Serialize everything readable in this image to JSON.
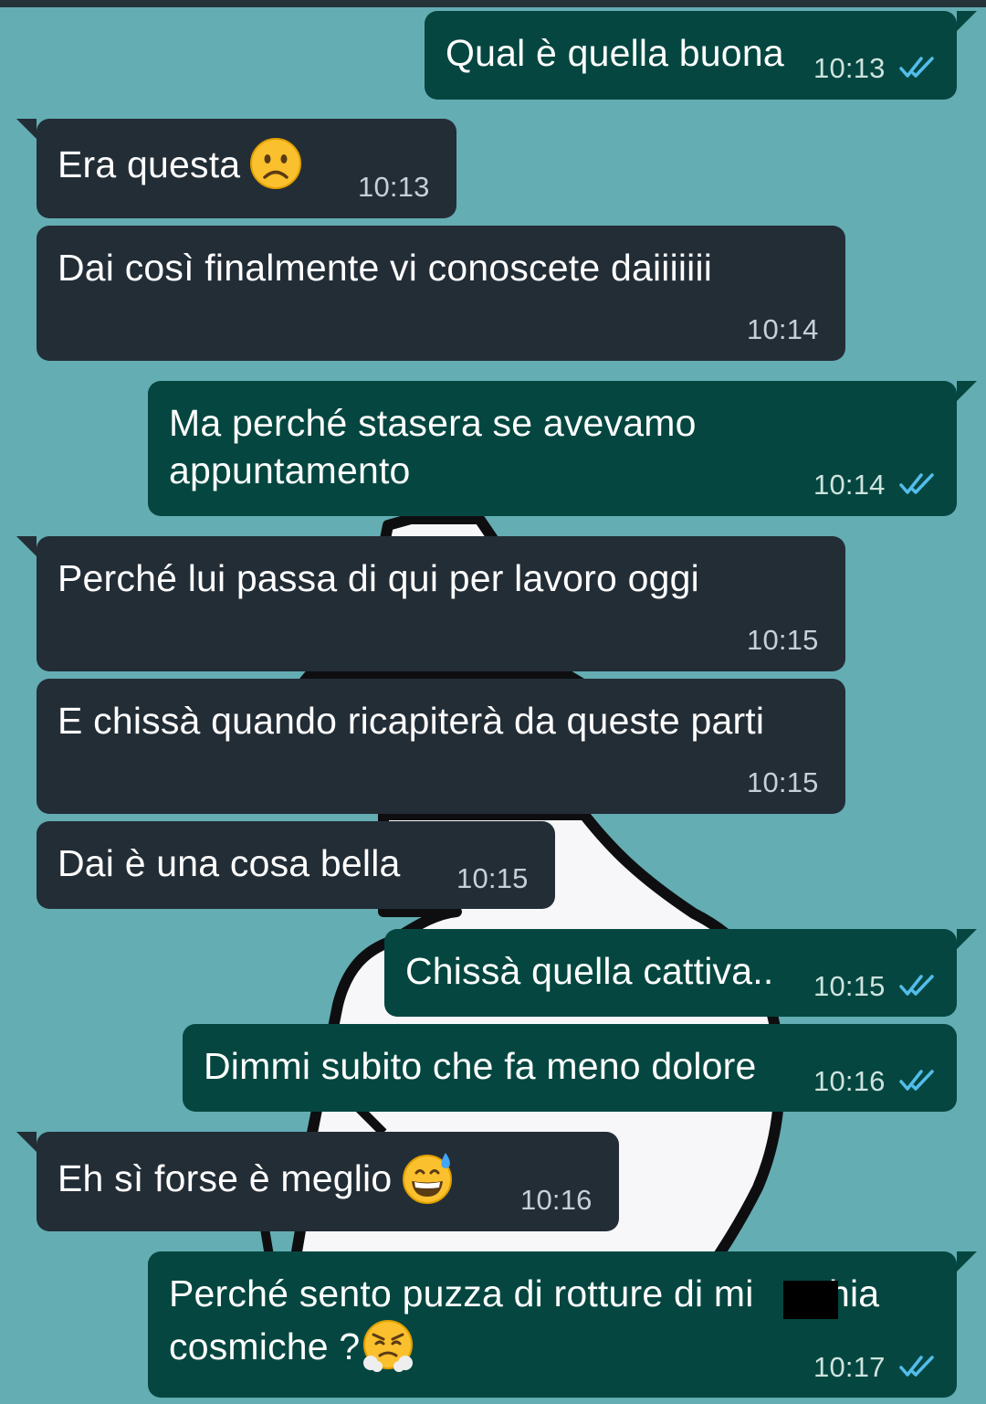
{
  "colors": {
    "background": "#63adb3",
    "incoming_bubble": "#232d36",
    "outgoing_bubble": "#054740",
    "read_ticks": "#53bdeb"
  },
  "messages": [
    {
      "direction": "outgoing",
      "text": "Qual è quella buona",
      "time": "10:13",
      "status": "read-double-tick-icon"
    },
    {
      "direction": "incoming",
      "text": "Era questa",
      "emoji": "frowning-face-emoji",
      "time": "10:13"
    },
    {
      "direction": "incoming",
      "text": "Dai così finalmente vi conoscete daiiiiiii",
      "time": "10:14"
    },
    {
      "direction": "outgoing",
      "lines": [
        "Ma perché stasera se avevamo",
        "appuntamento"
      ],
      "time": "10:14",
      "status": "read-double-tick-icon"
    },
    {
      "direction": "incoming",
      "text": "Perché lui passa di qui per lavoro oggi",
      "time": "10:15"
    },
    {
      "direction": "incoming",
      "text": "E chissà quando ricapiterà da queste parti",
      "time": "10:15"
    },
    {
      "direction": "incoming",
      "text": "Dai è una cosa bella",
      "time": "10:15"
    },
    {
      "direction": "outgoing",
      "text": "Chissà quella cattiva..",
      "time": "10:15",
      "status": "read-double-tick-icon"
    },
    {
      "direction": "outgoing",
      "text": "Dimmi subito che fa meno dolore",
      "time": "10:16",
      "status": "read-double-tick-icon"
    },
    {
      "direction": "incoming",
      "text": "Eh sì forse è meglio",
      "emoji": "grinning-sweat-emoji",
      "time": "10:16"
    },
    {
      "direction": "outgoing",
      "lines": [
        "Perché sento puzza di rotture di mi  hia",
        "cosmiche ?"
      ],
      "emoji": "steam-from-nose-emoji",
      "time": "10:17",
      "status": "read-double-tick-icon"
    }
  ]
}
